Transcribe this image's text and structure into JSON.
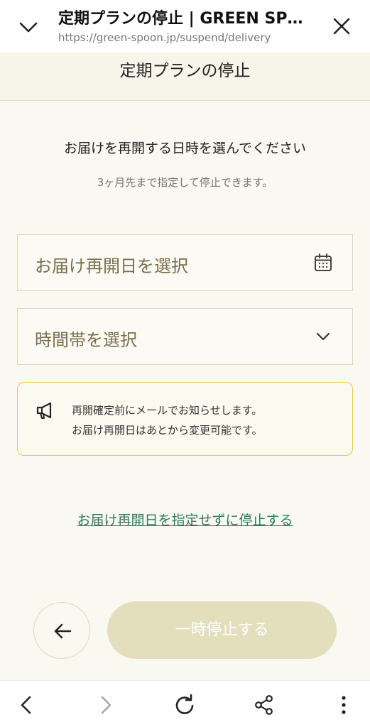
{
  "browser": {
    "title": "定期プランの停止 | GREEN SP…",
    "url": "https://green-spoon.jp/suspend/delivery"
  },
  "page": {
    "title": "定期プランの停止",
    "heading": "お届けを再開する日時を選んでください",
    "subnote": "3ヶ月先まで指定して停止できます。"
  },
  "date_field": {
    "placeholder": "お届け再開日を選択",
    "icon": "calendar-icon"
  },
  "time_field": {
    "placeholder": "時間帯を選択",
    "icon": "chevron-down-icon"
  },
  "notice": {
    "icon": "megaphone-icon",
    "line1": "再開確定前にメールでお知らせします。",
    "line2": "お届け再開日はあとから変更可能です。"
  },
  "skip_link": "お届け再開日を指定せずに停止する",
  "actions": {
    "back_icon": "arrow-left-icon",
    "pause_label": "一時停止する"
  },
  "bottom_nav": [
    "back-icon",
    "forward-icon",
    "reload-icon",
    "share-icon",
    "more-icon"
  ],
  "colors": {
    "page_bg": "#f9f8f1",
    "field_border": "#ddd8b8",
    "placeholder": "#7a6e4e",
    "notice_border": "#e6c94a",
    "link": "#2f7a5d",
    "button_disabled": "#e3dfbd"
  }
}
